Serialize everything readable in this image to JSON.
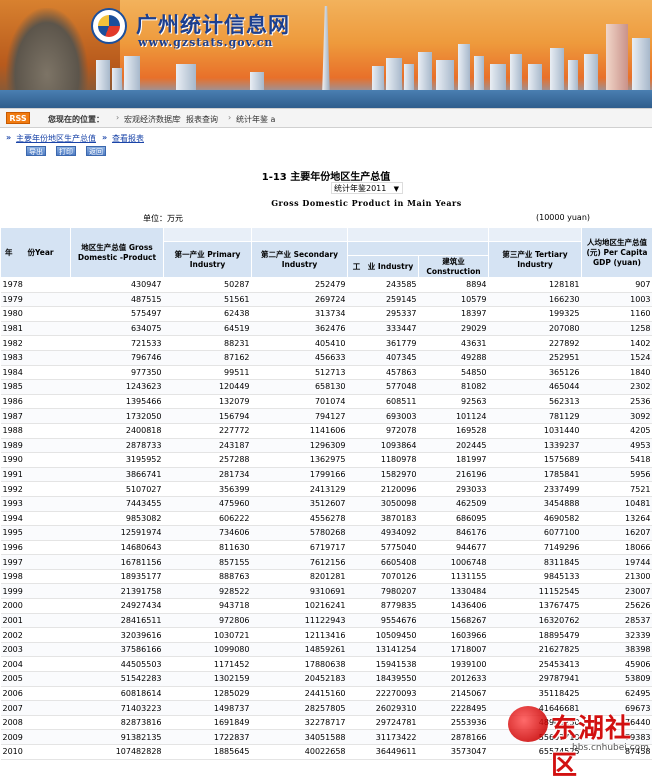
{
  "banner": {
    "title": "广州统计信息网",
    "url": "www.gzstats.gov.cn"
  },
  "locbar": {
    "rss": "RSS",
    "label": "您现在的位置：",
    "crumbs": [
      "宏观经济数据库",
      "报表查询",
      "统计年鉴 a"
    ]
  },
  "subnav": {
    "link1": "主要年份地区生产总值",
    "link2": "查看报表",
    "buttons": [
      "导出",
      "打印",
      "返回"
    ]
  },
  "table": {
    "title": "1-13 主要年份地区生产总值",
    "year_select": "统计年鉴2011",
    "subtitle": "Gross Domestic Product in Main Years",
    "unit_left": "单位：万元",
    "unit_right": "(10000 yuan)",
    "headers": {
      "year": "年　　份Year",
      "gdp": "地区生产总值 Gross Domestic -Product",
      "primary": "第一产业 Primary Industry",
      "secondary": "第二产业 Secondary Industry",
      "industry": "工　业 Industry",
      "construction": "建筑业 Construction",
      "tertiary": "第三产业 Tertiary Industry",
      "per_capita": "人均地区生产总值(元) Per Capita GDP (yuan)"
    },
    "rows": [
      [
        "1978",
        "430947",
        "50287",
        "252479",
        "243585",
        "8894",
        "128181",
        "907"
      ],
      [
        "1979",
        "487515",
        "51561",
        "269724",
        "259145",
        "10579",
        "166230",
        "1003"
      ],
      [
        "1980",
        "575497",
        "62438",
        "313734",
        "295337",
        "18397",
        "199325",
        "1160"
      ],
      [
        "1981",
        "634075",
        "64519",
        "362476",
        "333447",
        "29029",
        "207080",
        "1258"
      ],
      [
        "1982",
        "721533",
        "88231",
        "405410",
        "361779",
        "43631",
        "227892",
        "1402"
      ],
      [
        "1983",
        "796746",
        "87162",
        "456633",
        "407345",
        "49288",
        "252951",
        "1524"
      ],
      [
        "1984",
        "977350",
        "99511",
        "512713",
        "457863",
        "54850",
        "365126",
        "1840"
      ],
      [
        "1985",
        "1243623",
        "120449",
        "658130",
        "577048",
        "81082",
        "465044",
        "2302"
      ],
      [
        "1986",
        "1395466",
        "132079",
        "701074",
        "608511",
        "92563",
        "562313",
        "2536"
      ],
      [
        "1987",
        "1732050",
        "156794",
        "794127",
        "693003",
        "101124",
        "781129",
        "3092"
      ],
      [
        "1988",
        "2400818",
        "227772",
        "1141606",
        "972078",
        "169528",
        "1031440",
        "4205"
      ],
      [
        "1989",
        "2878733",
        "243187",
        "1296309",
        "1093864",
        "202445",
        "1339237",
        "4953"
      ],
      [
        "1990",
        "3195952",
        "257288",
        "1362975",
        "1180978",
        "181997",
        "1575689",
        "5418"
      ],
      [
        "1991",
        "3866741",
        "281734",
        "1799166",
        "1582970",
        "216196",
        "1785841",
        "5956"
      ],
      [
        "1992",
        "5107027",
        "356399",
        "2413129",
        "2120096",
        "293033",
        "2337499",
        "7521"
      ],
      [
        "1993",
        "7443455",
        "475960",
        "3512607",
        "3050098",
        "462509",
        "3454888",
        "10481"
      ],
      [
        "1994",
        "9853082",
        "606222",
        "4556278",
        "3870183",
        "686095",
        "4690582",
        "13264"
      ],
      [
        "1995",
        "12591974",
        "734606",
        "5780268",
        "4934092",
        "846176",
        "6077100",
        "16207"
      ],
      [
        "1996",
        "14680643",
        "811630",
        "6719717",
        "5775040",
        "944677",
        "7149296",
        "18066"
      ],
      [
        "1997",
        "16781156",
        "857155",
        "7612156",
        "6605408",
        "1006748",
        "8311845",
        "19744"
      ],
      [
        "1998",
        "18935177",
        "888763",
        "8201281",
        "7070126",
        "1131155",
        "9845133",
        "21300"
      ],
      [
        "1999",
        "21391758",
        "928522",
        "9310691",
        "7980207",
        "1330484",
        "11152545",
        "23007"
      ],
      [
        "2000",
        "24927434",
        "943718",
        "10216241",
        "8779835",
        "1436406",
        "13767475",
        "25626"
      ],
      [
        "2001",
        "28416511",
        "972806",
        "11122943",
        "9554676",
        "1568267",
        "16320762",
        "28537"
      ],
      [
        "2002",
        "32039616",
        "1030721",
        "12113416",
        "10509450",
        "1603966",
        "18895479",
        "32339"
      ],
      [
        "2003",
        "37586166",
        "1099080",
        "14859261",
        "13141254",
        "1718007",
        "21627825",
        "38398"
      ],
      [
        "2004",
        "44505503",
        "1171452",
        "17880638",
        "15941538",
        "1939100",
        "25453413",
        "45906"
      ],
      [
        "2005",
        "51542283",
        "1302159",
        "20452183",
        "18439550",
        "2012633",
        "29787941",
        "53809"
      ],
      [
        "2006",
        "60818614",
        "1285029",
        "24415160",
        "22270093",
        "2145067",
        "35118425",
        "62495"
      ],
      [
        "2007",
        "71403223",
        "1498737",
        "28257805",
        "26029310",
        "2228495",
        "41646681",
        "69673"
      ],
      [
        "2008",
        "82873816",
        "1691849",
        "32278717",
        "29724781",
        "2553936",
        "48903250",
        "76440"
      ],
      [
        "2009",
        "91382135",
        "1722837",
        "34051588",
        "31173422",
        "2878166",
        "55607710",
        "79383"
      ],
      [
        "2010",
        "107482828",
        "1885645",
        "40022658",
        "36449611",
        "3573047",
        "65574525",
        "87458"
      ]
    ]
  },
  "watermark": {
    "text": "东湖社区",
    "url": "bbs.cnhubei.com"
  }
}
